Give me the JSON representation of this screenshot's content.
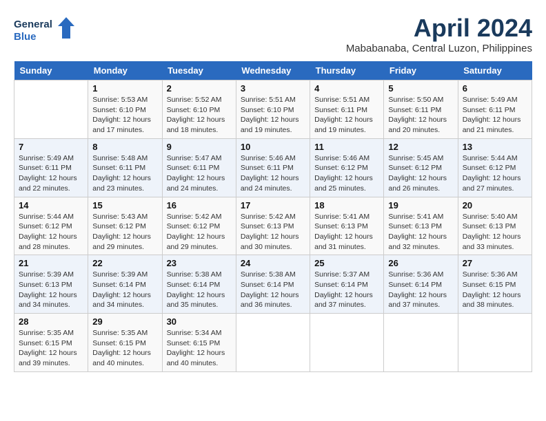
{
  "header": {
    "logo_line1": "General",
    "logo_line2": "Blue",
    "month_year": "April 2024",
    "location": "Mababanaba, Central Luzon, Philippines"
  },
  "weekdays": [
    "Sunday",
    "Monday",
    "Tuesday",
    "Wednesday",
    "Thursday",
    "Friday",
    "Saturday"
  ],
  "weeks": [
    [
      {
        "day": "",
        "info": ""
      },
      {
        "day": "1",
        "info": "Sunrise: 5:53 AM\nSunset: 6:10 PM\nDaylight: 12 hours\nand 17 minutes."
      },
      {
        "day": "2",
        "info": "Sunrise: 5:52 AM\nSunset: 6:10 PM\nDaylight: 12 hours\nand 18 minutes."
      },
      {
        "day": "3",
        "info": "Sunrise: 5:51 AM\nSunset: 6:10 PM\nDaylight: 12 hours\nand 19 minutes."
      },
      {
        "day": "4",
        "info": "Sunrise: 5:51 AM\nSunset: 6:11 PM\nDaylight: 12 hours\nand 19 minutes."
      },
      {
        "day": "5",
        "info": "Sunrise: 5:50 AM\nSunset: 6:11 PM\nDaylight: 12 hours\nand 20 minutes."
      },
      {
        "day": "6",
        "info": "Sunrise: 5:49 AM\nSunset: 6:11 PM\nDaylight: 12 hours\nand 21 minutes."
      }
    ],
    [
      {
        "day": "7",
        "info": "Sunrise: 5:49 AM\nSunset: 6:11 PM\nDaylight: 12 hours\nand 22 minutes."
      },
      {
        "day": "8",
        "info": "Sunrise: 5:48 AM\nSunset: 6:11 PM\nDaylight: 12 hours\nand 23 minutes."
      },
      {
        "day": "9",
        "info": "Sunrise: 5:47 AM\nSunset: 6:11 PM\nDaylight: 12 hours\nand 24 minutes."
      },
      {
        "day": "10",
        "info": "Sunrise: 5:46 AM\nSunset: 6:11 PM\nDaylight: 12 hours\nand 24 minutes."
      },
      {
        "day": "11",
        "info": "Sunrise: 5:46 AM\nSunset: 6:12 PM\nDaylight: 12 hours\nand 25 minutes."
      },
      {
        "day": "12",
        "info": "Sunrise: 5:45 AM\nSunset: 6:12 PM\nDaylight: 12 hours\nand 26 minutes."
      },
      {
        "day": "13",
        "info": "Sunrise: 5:44 AM\nSunset: 6:12 PM\nDaylight: 12 hours\nand 27 minutes."
      }
    ],
    [
      {
        "day": "14",
        "info": "Sunrise: 5:44 AM\nSunset: 6:12 PM\nDaylight: 12 hours\nand 28 minutes."
      },
      {
        "day": "15",
        "info": "Sunrise: 5:43 AM\nSunset: 6:12 PM\nDaylight: 12 hours\nand 29 minutes."
      },
      {
        "day": "16",
        "info": "Sunrise: 5:42 AM\nSunset: 6:12 PM\nDaylight: 12 hours\nand 29 minutes."
      },
      {
        "day": "17",
        "info": "Sunrise: 5:42 AM\nSunset: 6:13 PM\nDaylight: 12 hours\nand 30 minutes."
      },
      {
        "day": "18",
        "info": "Sunrise: 5:41 AM\nSunset: 6:13 PM\nDaylight: 12 hours\nand 31 minutes."
      },
      {
        "day": "19",
        "info": "Sunrise: 5:41 AM\nSunset: 6:13 PM\nDaylight: 12 hours\nand 32 minutes."
      },
      {
        "day": "20",
        "info": "Sunrise: 5:40 AM\nSunset: 6:13 PM\nDaylight: 12 hours\nand 33 minutes."
      }
    ],
    [
      {
        "day": "21",
        "info": "Sunrise: 5:39 AM\nSunset: 6:13 PM\nDaylight: 12 hours\nand 34 minutes."
      },
      {
        "day": "22",
        "info": "Sunrise: 5:39 AM\nSunset: 6:14 PM\nDaylight: 12 hours\nand 34 minutes."
      },
      {
        "day": "23",
        "info": "Sunrise: 5:38 AM\nSunset: 6:14 PM\nDaylight: 12 hours\nand 35 minutes."
      },
      {
        "day": "24",
        "info": "Sunrise: 5:38 AM\nSunset: 6:14 PM\nDaylight: 12 hours\nand 36 minutes."
      },
      {
        "day": "25",
        "info": "Sunrise: 5:37 AM\nSunset: 6:14 PM\nDaylight: 12 hours\nand 37 minutes."
      },
      {
        "day": "26",
        "info": "Sunrise: 5:36 AM\nSunset: 6:14 PM\nDaylight: 12 hours\nand 37 minutes."
      },
      {
        "day": "27",
        "info": "Sunrise: 5:36 AM\nSunset: 6:15 PM\nDaylight: 12 hours\nand 38 minutes."
      }
    ],
    [
      {
        "day": "28",
        "info": "Sunrise: 5:35 AM\nSunset: 6:15 PM\nDaylight: 12 hours\nand 39 minutes."
      },
      {
        "day": "29",
        "info": "Sunrise: 5:35 AM\nSunset: 6:15 PM\nDaylight: 12 hours\nand 40 minutes."
      },
      {
        "day": "30",
        "info": "Sunrise: 5:34 AM\nSunset: 6:15 PM\nDaylight: 12 hours\nand 40 minutes."
      },
      {
        "day": "",
        "info": ""
      },
      {
        "day": "",
        "info": ""
      },
      {
        "day": "",
        "info": ""
      },
      {
        "day": "",
        "info": ""
      }
    ]
  ]
}
